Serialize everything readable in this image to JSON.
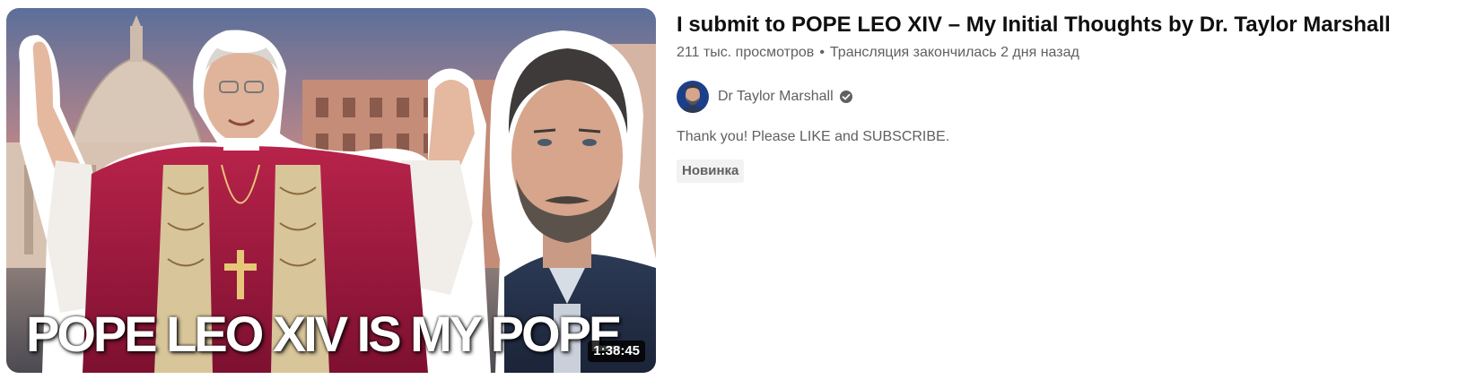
{
  "video": {
    "thumbnail_text": "POPE LEO XIV IS MY POPE",
    "duration": "1:38:45",
    "title": "I submit to POPE LEO XIV – My Initial Thoughts by Dr. Taylor Marshall",
    "views": "211 тыс. просмотров",
    "separator": "•",
    "streamed": "Трансляция закончилась 2 дня назад",
    "channel_name": "Dr Taylor Marshall",
    "verified_icon": "verified-check-icon",
    "description": "Thank you! Please LIKE and SUBSCRIBE.",
    "badge": "Новинка"
  },
  "colors": {
    "title": "#0f0f0f",
    "secondary": "#606060",
    "badge_bg": "#f2f2f2",
    "sky_top": "#5b6f9a",
    "sky_bottom": "#e8a37a"
  }
}
